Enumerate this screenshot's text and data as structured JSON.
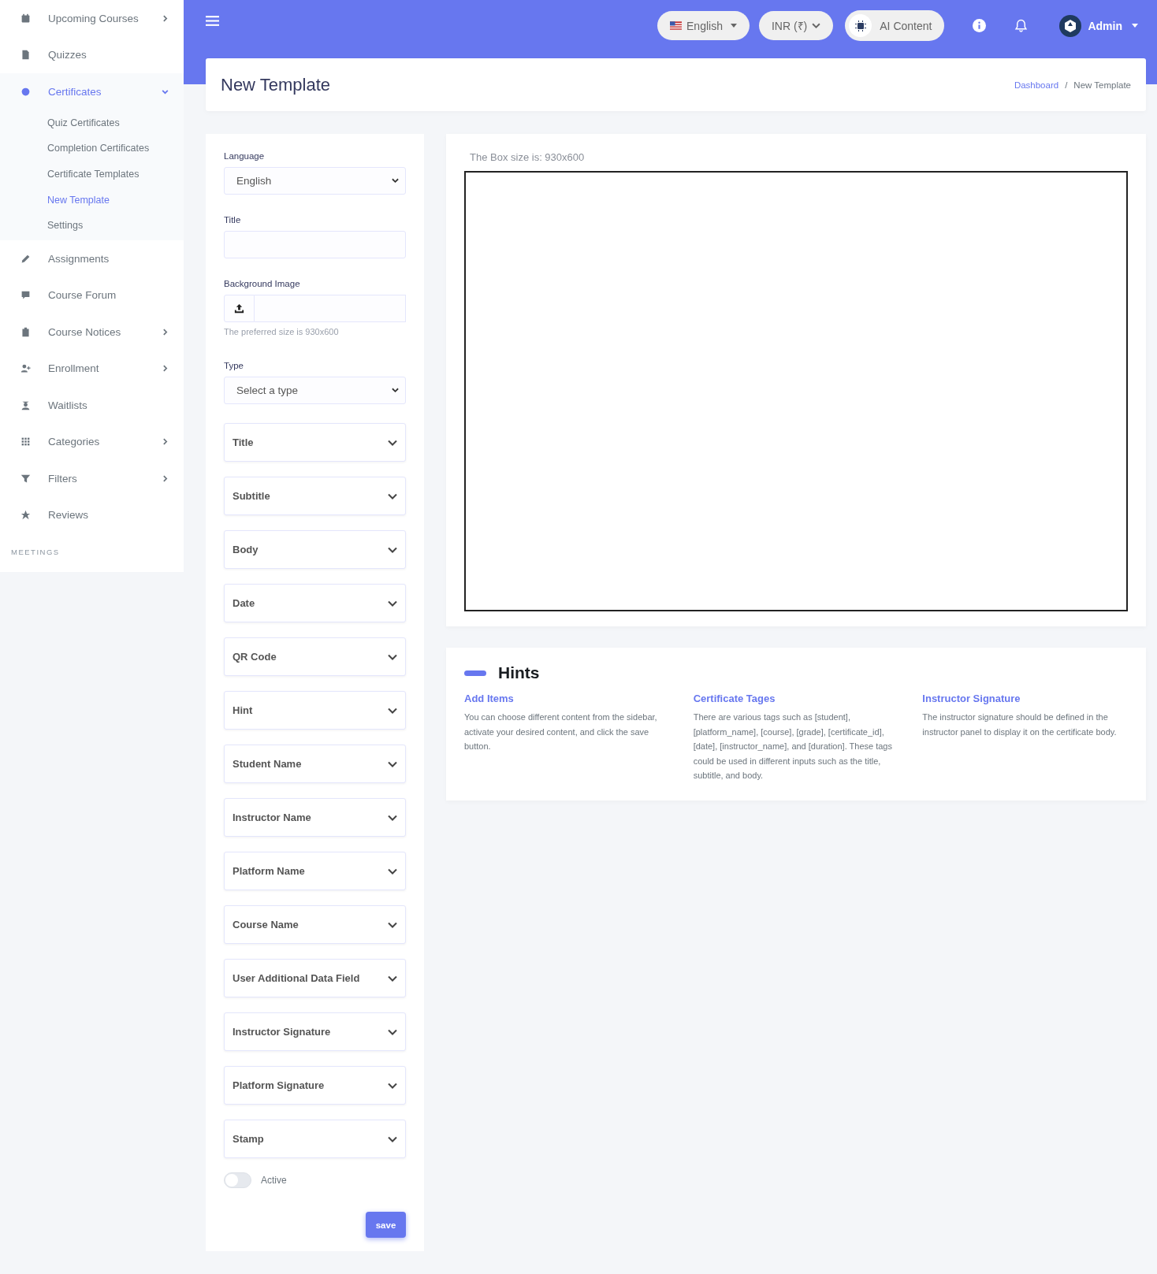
{
  "sidebar": {
    "items": [
      {
        "label": "Upcoming Courses",
        "kind": "menu",
        "expanded": false,
        "selected": false
      },
      {
        "label": "Quizzes",
        "kind": "link",
        "selected": false
      },
      {
        "label": "Certificates",
        "kind": "menu",
        "expanded": true,
        "selected": true,
        "children": [
          {
            "label": "Quiz Certificates",
            "selected": false
          },
          {
            "label": "Completion Certificates",
            "selected": false
          },
          {
            "label": "Certificate Templates",
            "selected": false
          },
          {
            "label": "New Template",
            "selected": true
          },
          {
            "label": "Settings",
            "selected": false
          }
        ]
      },
      {
        "label": "Assignments",
        "kind": "link",
        "selected": false
      },
      {
        "label": "Course Forum",
        "kind": "link",
        "selected": false
      },
      {
        "label": "Course Notices",
        "kind": "menu",
        "expanded": false,
        "selected": false
      },
      {
        "label": "Enrollment",
        "kind": "menu",
        "expanded": false,
        "selected": false
      },
      {
        "label": "Waitlists",
        "kind": "link",
        "selected": false
      },
      {
        "label": "Categories",
        "kind": "menu",
        "expanded": false,
        "selected": false
      },
      {
        "label": "Filters",
        "kind": "menu",
        "expanded": false,
        "selected": false
      },
      {
        "label": "Reviews",
        "kind": "link",
        "selected": false
      }
    ],
    "section_heading": "MEETINGS"
  },
  "header": {
    "language": "English",
    "currency": "INR (₹)",
    "ai_button": "AI Content",
    "user": "Admin"
  },
  "page": {
    "title": "New Template",
    "breadcrumb": [
      "Dashboard",
      "New Template"
    ],
    "breadcrumb_separator": "/"
  },
  "form": {
    "language_label": "Language",
    "language_value": "English",
    "title_label": "Title",
    "background_label": "Background Image",
    "background_hint": "The preferred size is 930x600",
    "type_label": "Type",
    "type_value": "Select a type",
    "sections": [
      "Title",
      "Subtitle",
      "Body",
      "Date",
      "QR Code",
      "Hint",
      "Student Name",
      "Instructor Name",
      "Platform Name",
      "Course Name",
      "User Additional Data Field",
      "Instructor Signature",
      "Platform Signature",
      "Stamp"
    ],
    "active": {
      "label": "Active",
      "on": false
    },
    "save": "save"
  },
  "preview": {
    "caption": "The Box size is: 930x600"
  },
  "hints": {
    "title": "Hints",
    "items": [
      {
        "heading": "Add Items",
        "text": "You can choose different content from the sidebar, activate your desired content, and click the save button."
      },
      {
        "heading": "Certificate Tages",
        "text": "There are various tags such as [student], [platform_name], [course], [grade], [certificate_id], [date], [instructor_name], and [duration]. These tags could be used in different inputs such as the title, subtitle, and body."
      },
      {
        "heading": "Instructor Signature",
        "text": "The instructor signature should be defined in the instructor panel to display it on the certificate body."
      }
    ]
  }
}
